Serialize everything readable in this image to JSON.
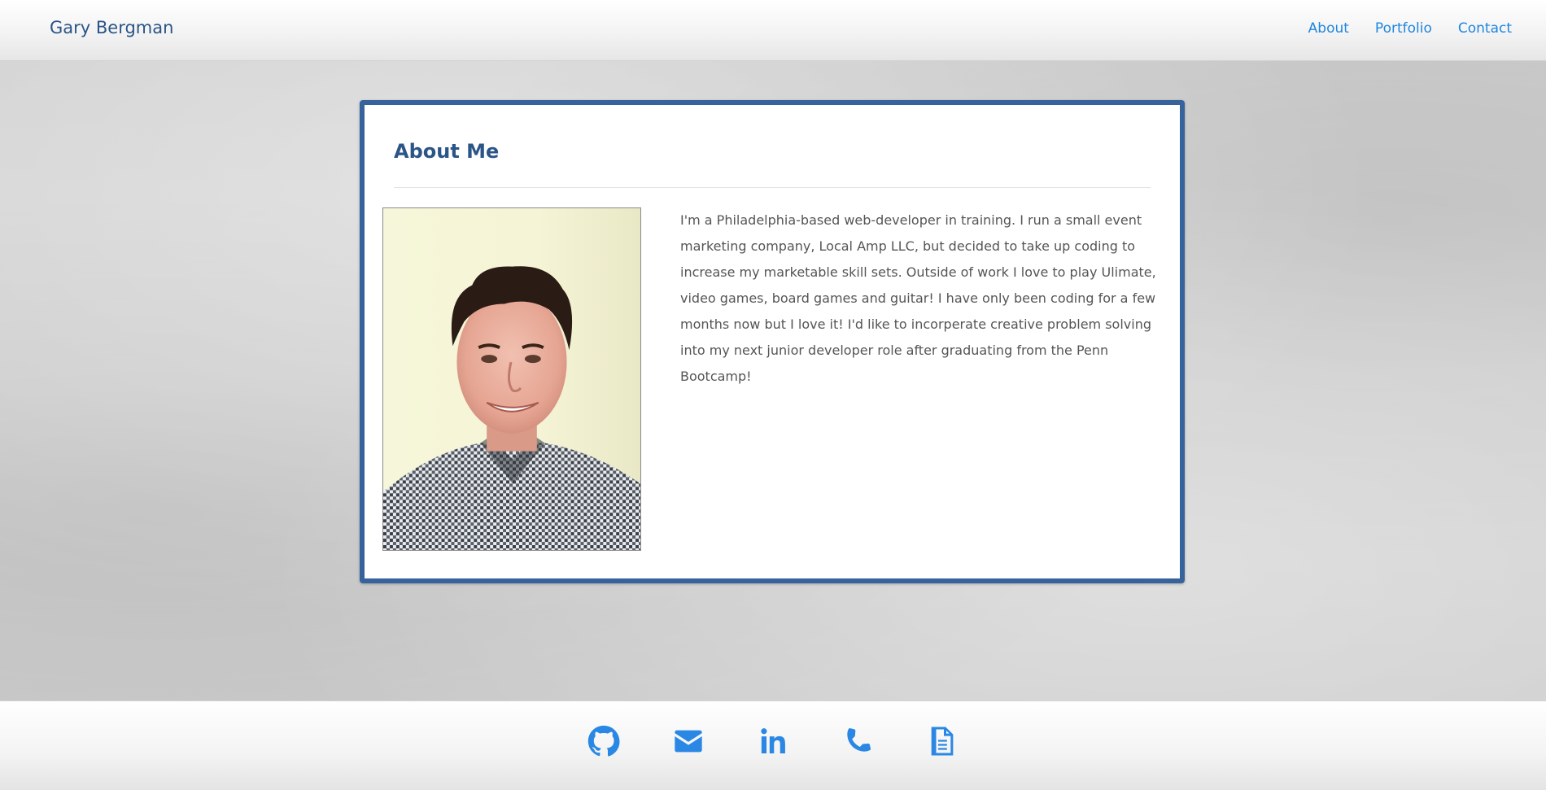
{
  "navbar": {
    "brand": "Gary Bergman",
    "links": [
      {
        "label": "About"
      },
      {
        "label": "Portfolio"
      },
      {
        "label": "Contact"
      }
    ]
  },
  "about": {
    "title": "About Me",
    "bio": "I'm a Philadelphia-based web-developer in training. I run a small event marketing company, Local Amp LLC, but decided to take up coding to increase my marketable skill sets. Outside of work I love to play Ulimate, video games, board games and guitar! I have only been coding for a few months now but I love it! I'd like to incorperate creative problem solving into my next junior developer role after graduating from the Penn Bootcamp!",
    "photo": "profile-photo"
  },
  "footer": {
    "icons": [
      "github-icon",
      "envelope-icon",
      "linkedin-icon",
      "phone-icon",
      "document-icon"
    ]
  },
  "colors": {
    "brand": "#2b5587",
    "link": "#1f86e0",
    "card_border": "#36639b",
    "icon": "#2a88e4"
  }
}
